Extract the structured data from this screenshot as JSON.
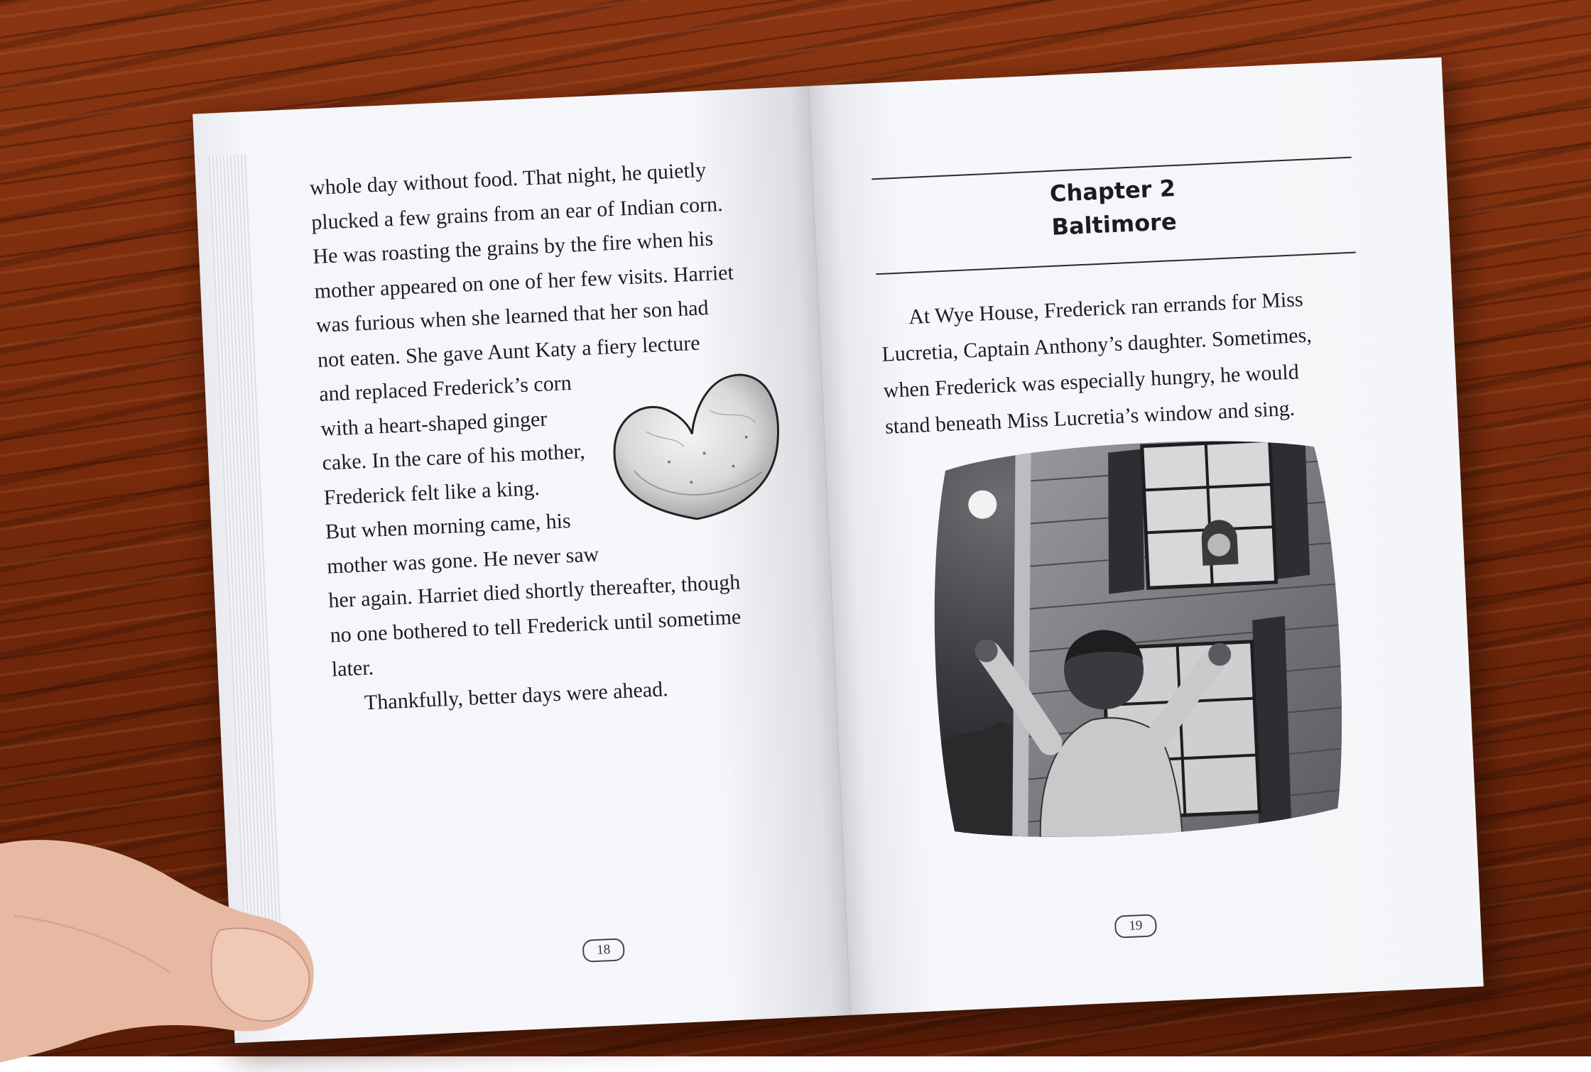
{
  "left_page": {
    "lines": [
      {
        "text": "whole day without food. That night, he quietly",
        "indent": false
      },
      {
        "text": "plucked a few grains from an ear of Indian corn.",
        "indent": false
      },
      {
        "text": "He was roasting the grains by the fire when his",
        "indent": false
      },
      {
        "text": "mother appeared on one of her few visits. Harriet",
        "indent": false
      },
      {
        "text": "was furious when she learned that her son had",
        "indent": false
      },
      {
        "text": "not eaten. She gave Aunt Katy a fiery lecture",
        "indent": false
      },
      {
        "text": "and replaced Frederick’s corn",
        "indent": false
      },
      {
        "text": "with a heart-shaped ginger",
        "indent": false
      },
      {
        "text": "cake. In the care of his mother,",
        "indent": false
      },
      {
        "text": "Frederick felt like a king.",
        "indent": false
      },
      {
        "text": "But when morning came, his",
        "indent": false
      },
      {
        "text": "mother was gone. He never saw",
        "indent": false
      },
      {
        "text": "her again. Harriet died shortly thereafter, though",
        "indent": false
      },
      {
        "text": "no one bothered to tell Frederick until sometime",
        "indent": false
      },
      {
        "text": "later.",
        "indent": false
      },
      {
        "text": "Thankfully, better days were ahead.",
        "indent": true
      }
    ],
    "page_number": "18",
    "illustration_icon": "heart-ginger-cake-icon"
  },
  "right_page": {
    "chapter_label": "Chapter 2",
    "chapter_title": "Baltimore",
    "lines": [
      {
        "text": "At Wye House, Frederick ran errands for Miss",
        "indent": true
      },
      {
        "text": "Lucretia, Captain Anthony’s daughter. Sometimes,",
        "indent": false
      },
      {
        "text": "when Frederick was especially hungry, he would",
        "indent": false
      },
      {
        "text": "stand beneath Miss Lucretia’s window and sing.",
        "indent": false
      }
    ],
    "page_number": "19",
    "illustration_icon": "boy-singing-under-window-icon"
  },
  "colors": {
    "table_wood": "#7a2c0c",
    "paper": "#f4f5f8",
    "ink": "#1e1e22"
  }
}
